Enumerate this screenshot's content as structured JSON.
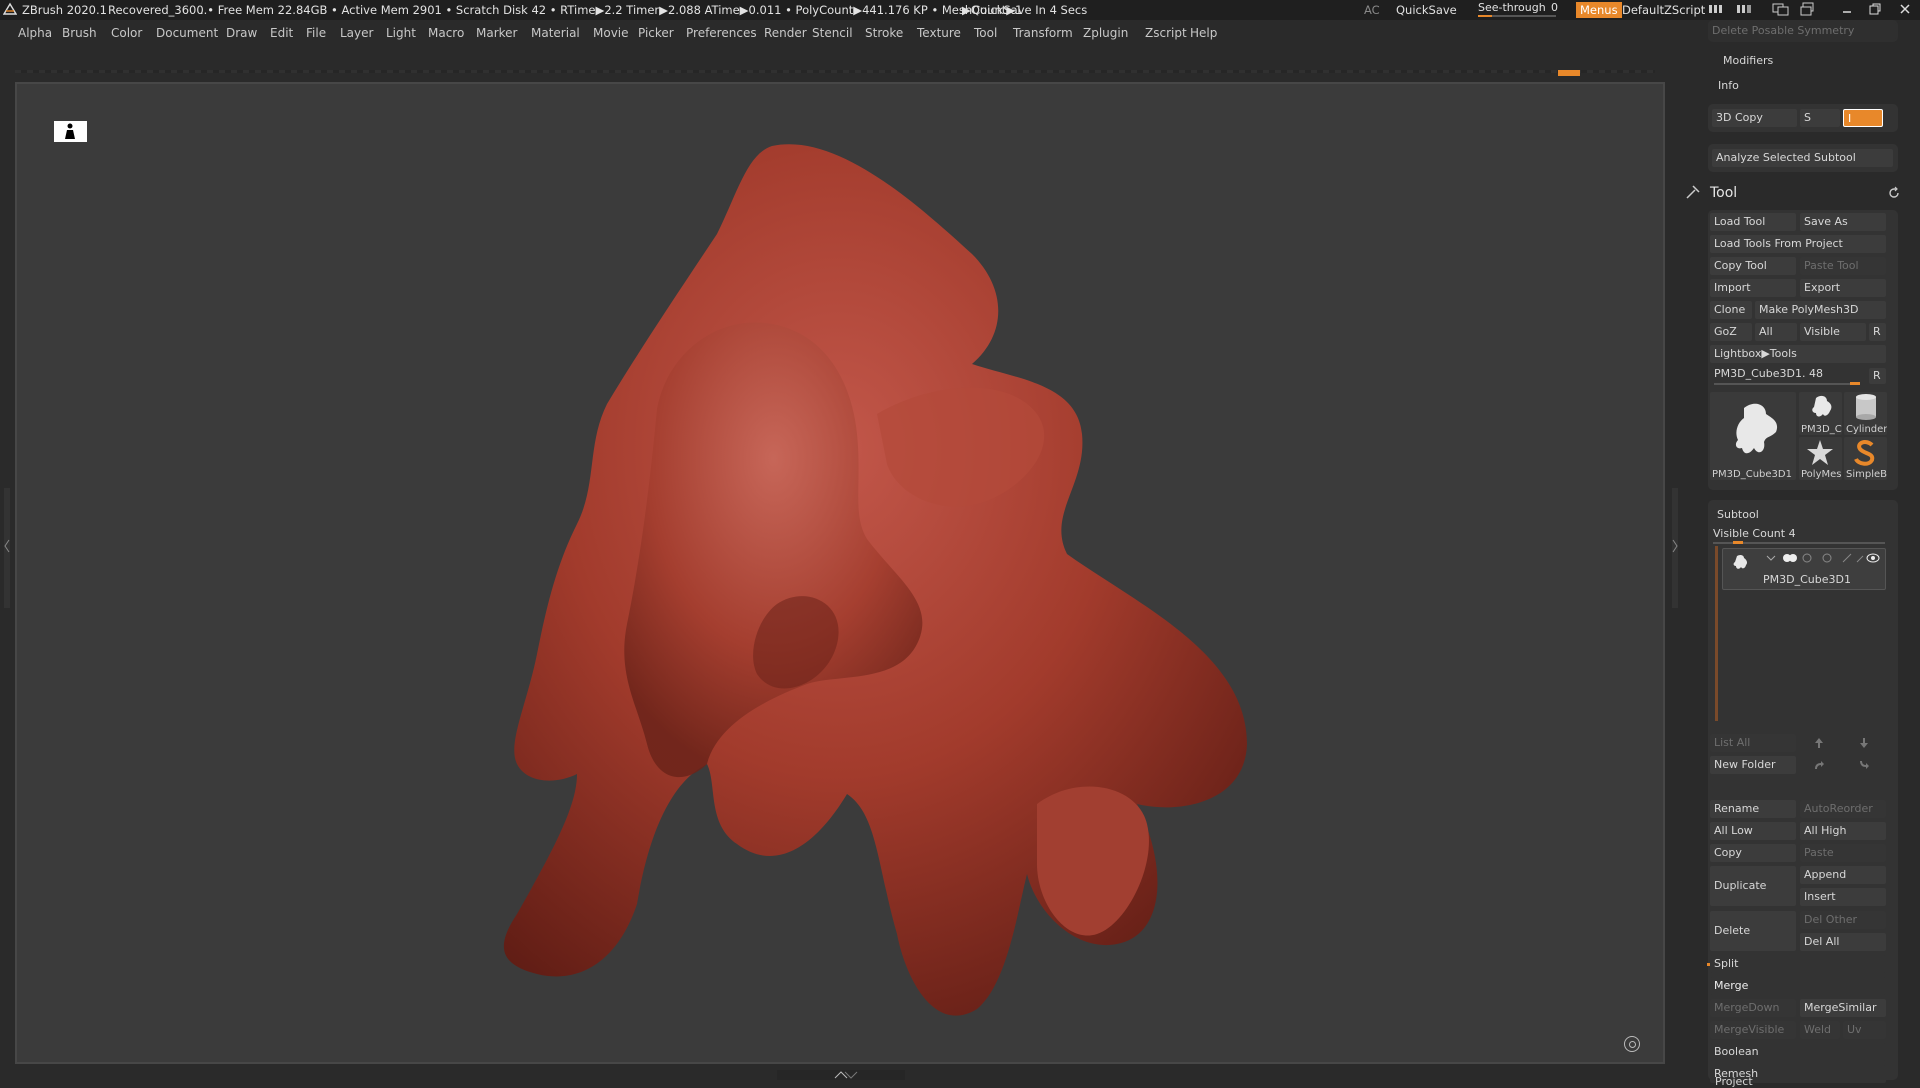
{
  "titlebar": {
    "app": "ZBrush 2020.1",
    "file": "Recovered_3600",
    "stats": "..• Free Mem 22.84GB • Active Mem 2901 • Scratch Disk 42 • RTime▶2.2 Timer▶2.088 ATime▶0.011 • PolyCount▶441.176 KP • MeshCount▶1",
    "quicksave_status": "▶QuickSave In 4 Secs",
    "ac": "AC",
    "quicksave": "QuickSave",
    "see_through_label": "See-through",
    "see_through_value": "0",
    "menus": "Menus",
    "default_zscript": "DefaultZScript",
    "see_through_level": 0.18
  },
  "menubar": [
    "Alpha",
    "Brush",
    "Color",
    "Document",
    "Draw",
    "Edit",
    "File",
    "Layer",
    "Light",
    "Macro",
    "Marker",
    "Material",
    "Movie",
    "Picker",
    "Preferences",
    "Render",
    "Stencil",
    "Stroke",
    "Texture",
    "Tool",
    "Transform",
    "Zplugin",
    "Zscript",
    "Help"
  ],
  "right_panel": {
    "delete_posable_symmetry": "Delete Posable Symmetry",
    "modifiers": "Modifiers",
    "info": "Info",
    "copy3d": "3D Copy",
    "copy3d_s": "S",
    "copy3d_i": "I",
    "analyze_subtool": "Analyze Selected Subtool",
    "tool_title": "Tool",
    "load_tool": "Load Tool",
    "save_as": "Save As",
    "load_tools_from_project": "Load Tools From Project",
    "copy_tool": "Copy Tool",
    "paste_tool": "Paste Tool",
    "import": "Import",
    "export": "Export",
    "clone": "Clone",
    "make_polymesh": "Make PolyMesh3D",
    "goz": "GoZ",
    "all": "All",
    "visible": "Visible",
    "r": "R",
    "lightbox_tools": "Lightbox▶Tools",
    "current_tool": "PM3D_Cube3D1. 48",
    "thumbs": [
      {
        "label": "PM3D_Cube3D1"
      },
      {
        "label": "PM3D_C"
      },
      {
        "label": "Cylinder"
      },
      {
        "label": "PolyMes"
      },
      {
        "label": "SimpleB"
      }
    ],
    "subtool_title": "Subtool",
    "visible_count": "Visible Count 4",
    "subtool_item": "PM3D_Cube3D1",
    "list_all": "List All",
    "new_folder": "New Folder",
    "rename": "Rename",
    "auto_reorder": "AutoReorder",
    "all_low": "All Low",
    "all_high": "All High",
    "copy": "Copy",
    "paste": "Paste",
    "append": "Append",
    "duplicate": "Duplicate",
    "insert": "Insert",
    "delete": "Delete",
    "del_other": "Del Other",
    "del_all": "Del All",
    "split": "Split",
    "merge": "Merge",
    "merge_down": "MergeDown",
    "merge_similar": "MergeSimilar",
    "merge_visible": "MergeVisible",
    "weld": "Weld",
    "uv": "Uv",
    "boolean": "Boolean",
    "remesh": "Remesh",
    "project": "Project"
  },
  "colors": {
    "accent": "#e8882a",
    "mesh": "#a33b2a",
    "canvas_bg": "#3b3b3b"
  }
}
